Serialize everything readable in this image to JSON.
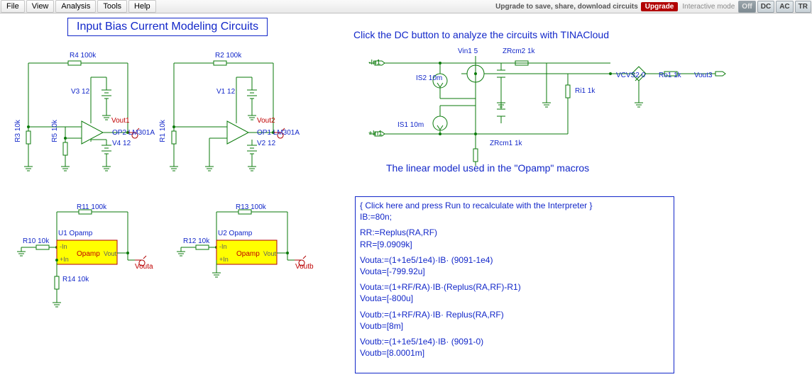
{
  "menu": {
    "file": "File",
    "view": "View",
    "analysis": "Analysis",
    "tools": "Tools",
    "help": "Help"
  },
  "toolbar": {
    "upgrade_text": "Upgrade to save, share, download circuits",
    "upgrade_btn": "Upgrade",
    "interactive": "Interactive mode",
    "off": "Off",
    "dc": "DC",
    "ac": "AC",
    "tr": "TR"
  },
  "title": "Input Bias Current Modeling Circuits",
  "hint1": "Click the DC button to analyze the circuits with TINACloud",
  "hint2": "The linear model used in the \"Opamp\" macros",
  "labels": {
    "R4": "R4 100k",
    "R2": "R2 100k",
    "R3": "R3 10k",
    "R1": "R1 10k",
    "R5": "R5 10k",
    "V3": "V3 12",
    "V1": "V1 12",
    "V4": "V4 12",
    "V2": "V2 12",
    "Vout1": "Vout1",
    "Vout2": "Vout2",
    "OP2": "OP2 LM301A",
    "OP1": "OP1 LM301A",
    "R11": "R11 100k",
    "R13": "R13 100k",
    "R10": "R10 10k",
    "R12": "R12 10k",
    "R14": "R14 10k",
    "U1": "U1 Opamp",
    "U2": "U2 Opamp",
    "Opamp": "Opamp",
    "VoutL": "Vout",
    "Vouta": "Vouta",
    "Voutb": "Voutb",
    "mIn": "-In",
    "pIn": "+In",
    "Vin1": "Vin1 5",
    "ZRcm2": "ZRcm2 1k",
    "ZRcm1": "ZRcm1 1k",
    "IS2": "IS2 10m",
    "IS1": "IS1 10m",
    "VCVS2": "VCVS2 0",
    "Ro1": "Ro1 1k",
    "Ri1": "Ri1 1k",
    "n_in1": "-In1",
    "p_in1": "+In1",
    "Vout3": "Vout3"
  },
  "interp": {
    "l0": "{ Click here and press Run to recalculate with the Interpreter }",
    "l1": "IB:=80n;",
    "l2": "RR:=Replus(RA,RF)",
    "l3": "RR=[9.0909k]",
    "l4": "Vouta:=(1+1e5/1e4)·IB· (9091-1e4)",
    "l5": "Vouta=[-799.92u]",
    "l6": "Vouta:=(1+RF/RA)·IB·(Replus(RA,RF)-R1)",
    "l7": "Vouta=[-800u]",
    "l8": "Voutb:=(1+RF/RA)·IB· Replus(RA,RF)",
    "l9": "Voutb=[8m]",
    "l10": "Voutb:=(1+1e5/1e4)·IB· (9091-0)",
    "l11": "Voutb=[8.0001m]"
  }
}
